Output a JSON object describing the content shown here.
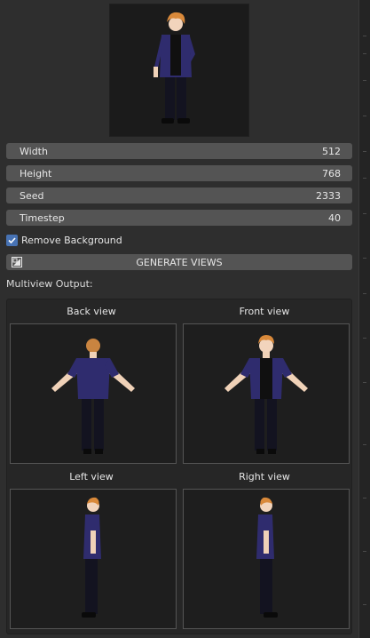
{
  "settings": {
    "width": {
      "label": "Width",
      "value": "512"
    },
    "height": {
      "label": "Height",
      "value": "768"
    },
    "seed": {
      "label": "Seed",
      "value": "2333"
    },
    "timestep": {
      "label": "Timestep",
      "value": "40"
    }
  },
  "remove_background": {
    "label": "Remove Background",
    "checked": true
  },
  "generate_button": {
    "label": "GENERATE VIEWS",
    "icon": "image-icon"
  },
  "multiview": {
    "label": "Multiview Output:",
    "views": [
      {
        "title": "Back view"
      },
      {
        "title": "Front view"
      },
      {
        "title": "Left view"
      },
      {
        "title": "Right view"
      }
    ]
  },
  "colors": {
    "field_bg": "#545454",
    "panel_bg": "#262626",
    "checkbox_accent": "#4772b3",
    "shirt": "#2f2c6e",
    "hair": "#d9893a"
  }
}
